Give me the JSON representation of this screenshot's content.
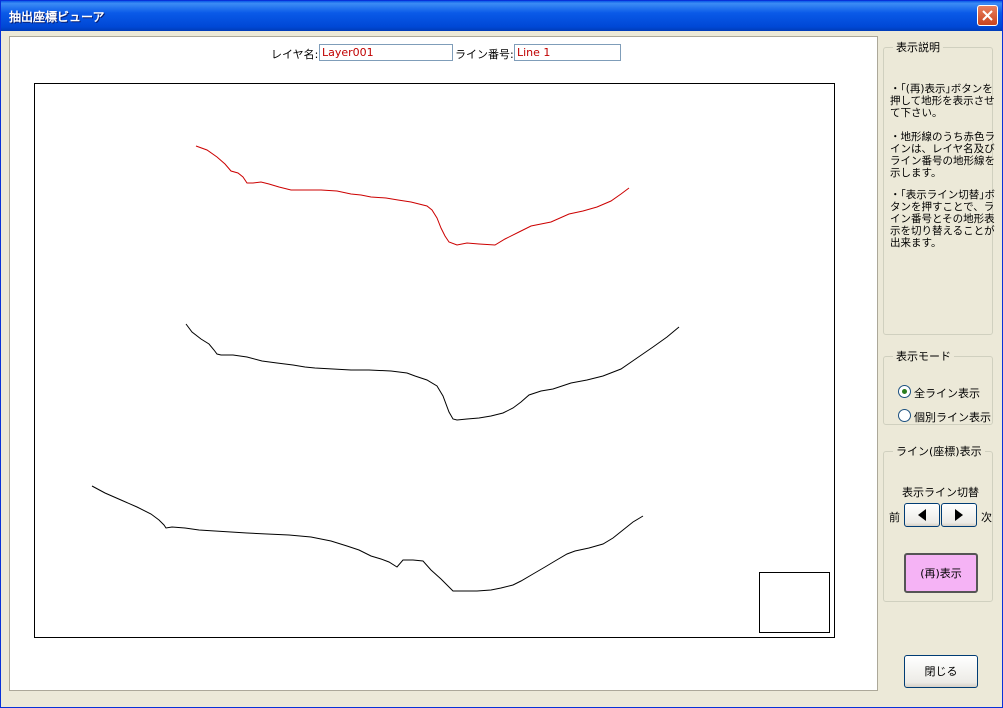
{
  "window": {
    "title": "抽出座標ビューア"
  },
  "header": {
    "layer_label": "レイヤ名:",
    "layer_value": "Layer001",
    "line_label": "ライン番号:",
    "line_value": "Line 1"
  },
  "colors": {
    "highlight_line": "#cc0000",
    "normal_line": "#000000"
  },
  "description": {
    "legend": "表示説明",
    "paragraphs": [
      "・｢(再)表示｣ボタンを押して地形を表示させて下さい。",
      "・地形線のうち赤色ラインは、レイヤ名及びライン番号の地形線を示します。",
      "・｢表示ライン切替｣ボタンを押すことで、ライン番号とその地形表示を切り替えることが出来ます。"
    ]
  },
  "mode": {
    "legend": "表示モード",
    "options": [
      {
        "label": "全ライン表示",
        "checked": true
      },
      {
        "label": "個別ライン表示",
        "checked": false
      }
    ]
  },
  "line_display": {
    "legend": "ライン(座標)表示",
    "switch_label": "表示ライン切替",
    "prev_label": "前",
    "next_label": "次",
    "prev_icon": "triangle-left-icon",
    "next_icon": "triangle-right-icon",
    "redisplay_label": "(再)表示"
  },
  "close_button_label": "閉じる"
}
